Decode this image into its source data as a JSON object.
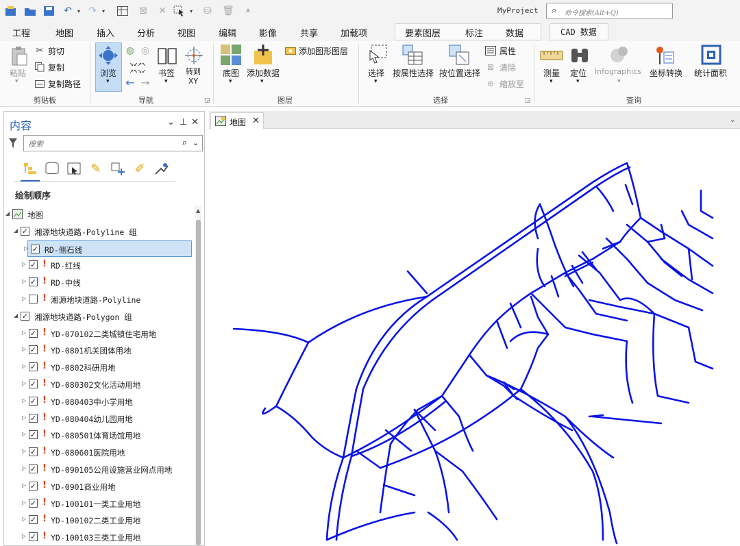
{
  "app": {
    "title": "MyProject"
  },
  "command_search": {
    "placeholder": "命令搜索(Alt+Q)"
  },
  "tabs": [
    "工程",
    "地图",
    "插入",
    "分析",
    "视图",
    "编辑",
    "影像",
    "共享",
    "加载项",
    "要素图层",
    "标注",
    "数据",
    "CAD 数据"
  ],
  "active_tab": "地图",
  "ribbon": {
    "clipboard": {
      "paste": "粘贴",
      "cut": "剪切",
      "copy": "复制",
      "copy_path": "复制路径",
      "label": "剪贴板"
    },
    "navigate": {
      "explore": "浏览",
      "bookmarks": "书签",
      "goto_xy": "转到\nXY",
      "label": "导航"
    },
    "layer": {
      "basemap": "底图",
      "add_data": "添加数据",
      "add_graphics_layer": "添加图形图层",
      "label": "图层"
    },
    "selection": {
      "select": "选择",
      "select_by_attr": "按属性选择",
      "select_by_loc": "按位置选择",
      "attributes": "属性",
      "clear": "清除",
      "zoom_to": "缩放至",
      "label": "选择"
    },
    "inquiry": {
      "measure": "测量",
      "locate": "定位",
      "infographics": "Infographics",
      "convert_coords": "坐标转换",
      "statistics_area": "统计面积",
      "label": "查询"
    }
  },
  "contents": {
    "title": "内容",
    "search_placeholder": "搜索",
    "draw_order": "绘制顺序",
    "rows": [
      {
        "label": "地图",
        "checked": null,
        "warn": false,
        "level": 0
      },
      {
        "label": "湘源地块道路-Polyline 组",
        "checked": true,
        "warn": false,
        "level": 1
      },
      {
        "label": "RD-侧石线",
        "checked": true,
        "warn": false,
        "level": 2,
        "selected": true
      },
      {
        "label": "RD-红线",
        "checked": true,
        "warn": true,
        "level": 2
      },
      {
        "label": "RD-中线",
        "checked": true,
        "warn": true,
        "level": 2
      },
      {
        "label": "湘源地块道路-Polyline",
        "checked": false,
        "warn": true,
        "level": 2
      },
      {
        "label": "湘源地块道路-Polygon 组",
        "checked": true,
        "warn": false,
        "level": 1
      },
      {
        "label": "YD-070102二类城镇住宅用地",
        "checked": true,
        "warn": true,
        "level": 2
      },
      {
        "label": "YD-0801机关团体用地",
        "checked": true,
        "warn": true,
        "level": 2
      },
      {
        "label": "YD-0802科研用地",
        "checked": true,
        "warn": true,
        "level": 2
      },
      {
        "label": "YD-080302文化活动用地",
        "checked": true,
        "warn": true,
        "level": 2
      },
      {
        "label": "YD-080403中小学用地",
        "checked": true,
        "warn": true,
        "level": 2
      },
      {
        "label": "YD-080404幼儿园用地",
        "checked": true,
        "warn": true,
        "level": 2
      },
      {
        "label": "YD-080501体育场馆用地",
        "checked": true,
        "warn": true,
        "level": 2
      },
      {
        "label": "YD-080601医院用地",
        "checked": true,
        "warn": true,
        "level": 2
      },
      {
        "label": "YD-090105公用设施营业网点用地",
        "checked": true,
        "warn": true,
        "level": 2
      },
      {
        "label": "YD-0901商业用地",
        "checked": true,
        "warn": true,
        "level": 2
      },
      {
        "label": "YD-100101一类工业用地",
        "checked": true,
        "warn": true,
        "level": 2
      },
      {
        "label": "YD-100102二类工业用地",
        "checked": true,
        "warn": true,
        "level": 2
      },
      {
        "label": "YD-100103三类工业用地",
        "checked": true,
        "warn": true,
        "level": 2
      }
    ]
  },
  "map_view": {
    "tab_label": "地图",
    "line_color": "#0a14e6"
  }
}
